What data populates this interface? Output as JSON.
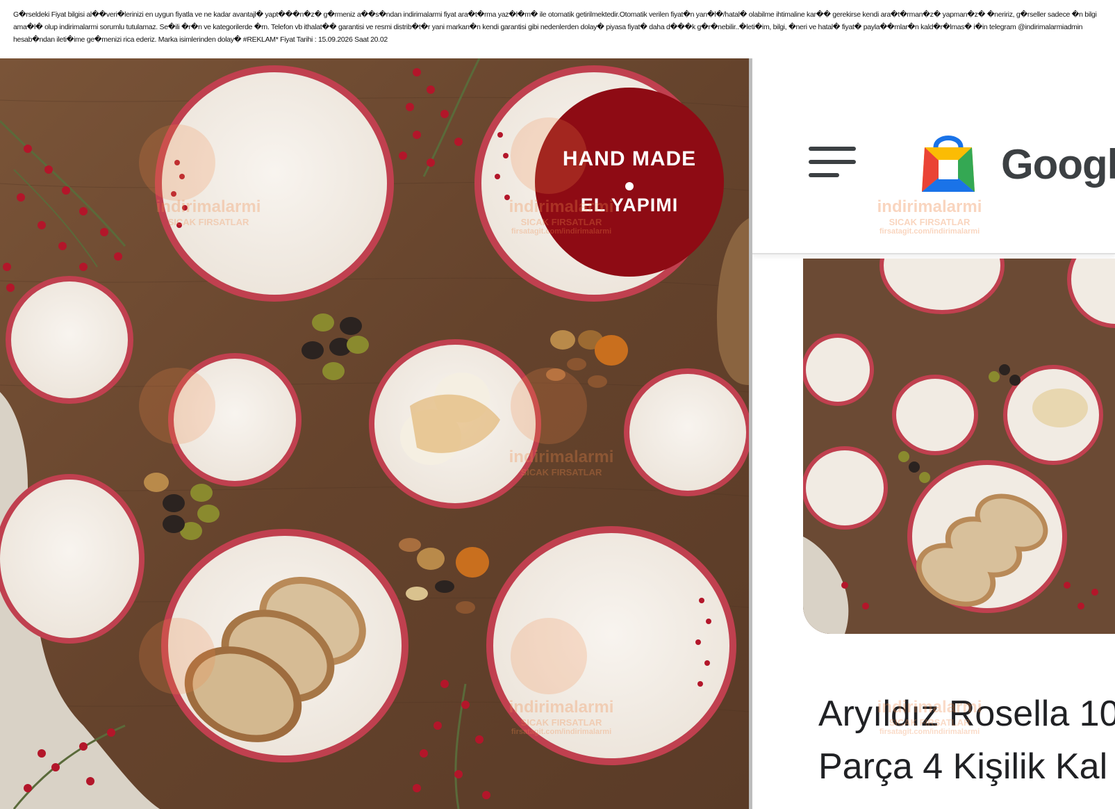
{
  "disclaimer": {
    "text": "G�rseldeki Fiyat bilgisi al��veri�lerinizi en uygun fiyatla ve ne kadar avantajl� yapt���n�z� g�rmeniz a��s�ndan indirimalarmi fiyat ara�t�rma yaz�l�m� ile otomatik getirilmektedir.Otomatik verilen fiyat�n yan�l�/hatal� olabilme ihtimaline kar�� gerekirse kendi ara�t�rman�z� yapman�z� �neririz, g�rseller sadece �n bilgi ama�l� olup indirimalarmi sorumlu tutulamaz. Se�ili �r�n ve kategorilerde �rn. Telefon vb ithalat�� garantisi ve resmi distrib�t�r yani markan�n kendi garantisi gibi nedenlerden dolay� piyasa fiyat� daha d���k g�r�nebilir..�leti�im, bilgi, �neri ve hatal� fiyat� payla��mlar�n kald�r�lmas� i�in telegram @indirimalarmiadmin hesab�ndan ileti�ime ge�menizi rica ederiz. Marka isimlerinden dolay� #REKLAM* Fiyat Tarihi : 15.09.2026 Saat 20.02"
  },
  "badge": {
    "line1": "HAND MADE",
    "line2": "EL YAPIMI"
  },
  "watermark": {
    "name": "indirimalarmi",
    "tagline": "SICAK FIRSATLAR",
    "url": "firsatagit.com/indirimalarmi"
  },
  "app_bar": {
    "brand": "Googl",
    "menu_icon": "hamburger-menu-icon",
    "logo_icon": "google-shopping-bag-icon"
  },
  "product": {
    "title_line1": "Aryıldız Rosella 10",
    "title_line2": "Parça 4 Kişilik Kal"
  },
  "colors": {
    "table_wood": "#6b4a34",
    "plate_rim": "#c0404f",
    "plate_body": "#f3ede6",
    "badge_red": "#8e0b14",
    "watermark_orange": "#f08a4b"
  }
}
